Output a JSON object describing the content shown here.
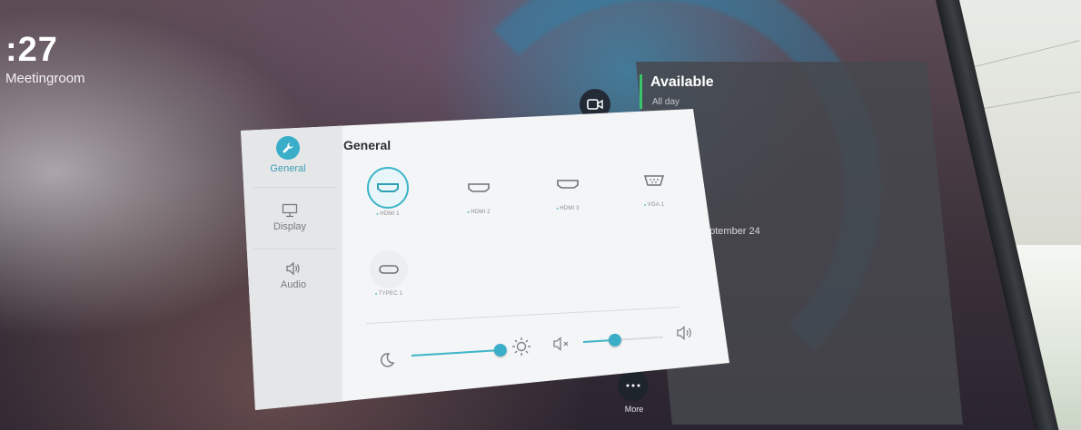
{
  "screen": {
    "clock": ":27",
    "room_name": "Meetingroom",
    "availability": {
      "title": "Available",
      "subtitle": "All day"
    },
    "date_text": "eptember 24",
    "more_label": "More"
  },
  "dialog": {
    "title": "General",
    "nav": [
      {
        "label": "General",
        "icon": "wrench-icon",
        "selected": true
      },
      {
        "label": "Display",
        "icon": "monitor-icon",
        "selected": false
      },
      {
        "label": "Audio",
        "icon": "speaker-icon",
        "selected": false
      }
    ],
    "sources": [
      {
        "label": "HDMI 1",
        "icon": "hdmi-icon",
        "selected": true
      },
      {
        "label": "HDMI 2",
        "icon": "hdmi-icon",
        "selected": false
      },
      {
        "label": "HDMI 3",
        "icon": "hdmi-icon",
        "selected": false
      },
      {
        "label": "VGA 1",
        "icon": "vga-icon",
        "selected": false
      },
      {
        "label": "TYPEC 1",
        "icon": "usb-c-icon",
        "selected": false
      }
    ],
    "brightness": {
      "value": 1.0,
      "icon_low": "moon-icon",
      "icon_high": "sun-icon"
    },
    "volume": {
      "value": 0.4,
      "icon_low": "mute-icon",
      "icon_high": "speaker-icon"
    }
  },
  "colors": {
    "accent": "#3aaec8",
    "available": "#3cc46c"
  }
}
